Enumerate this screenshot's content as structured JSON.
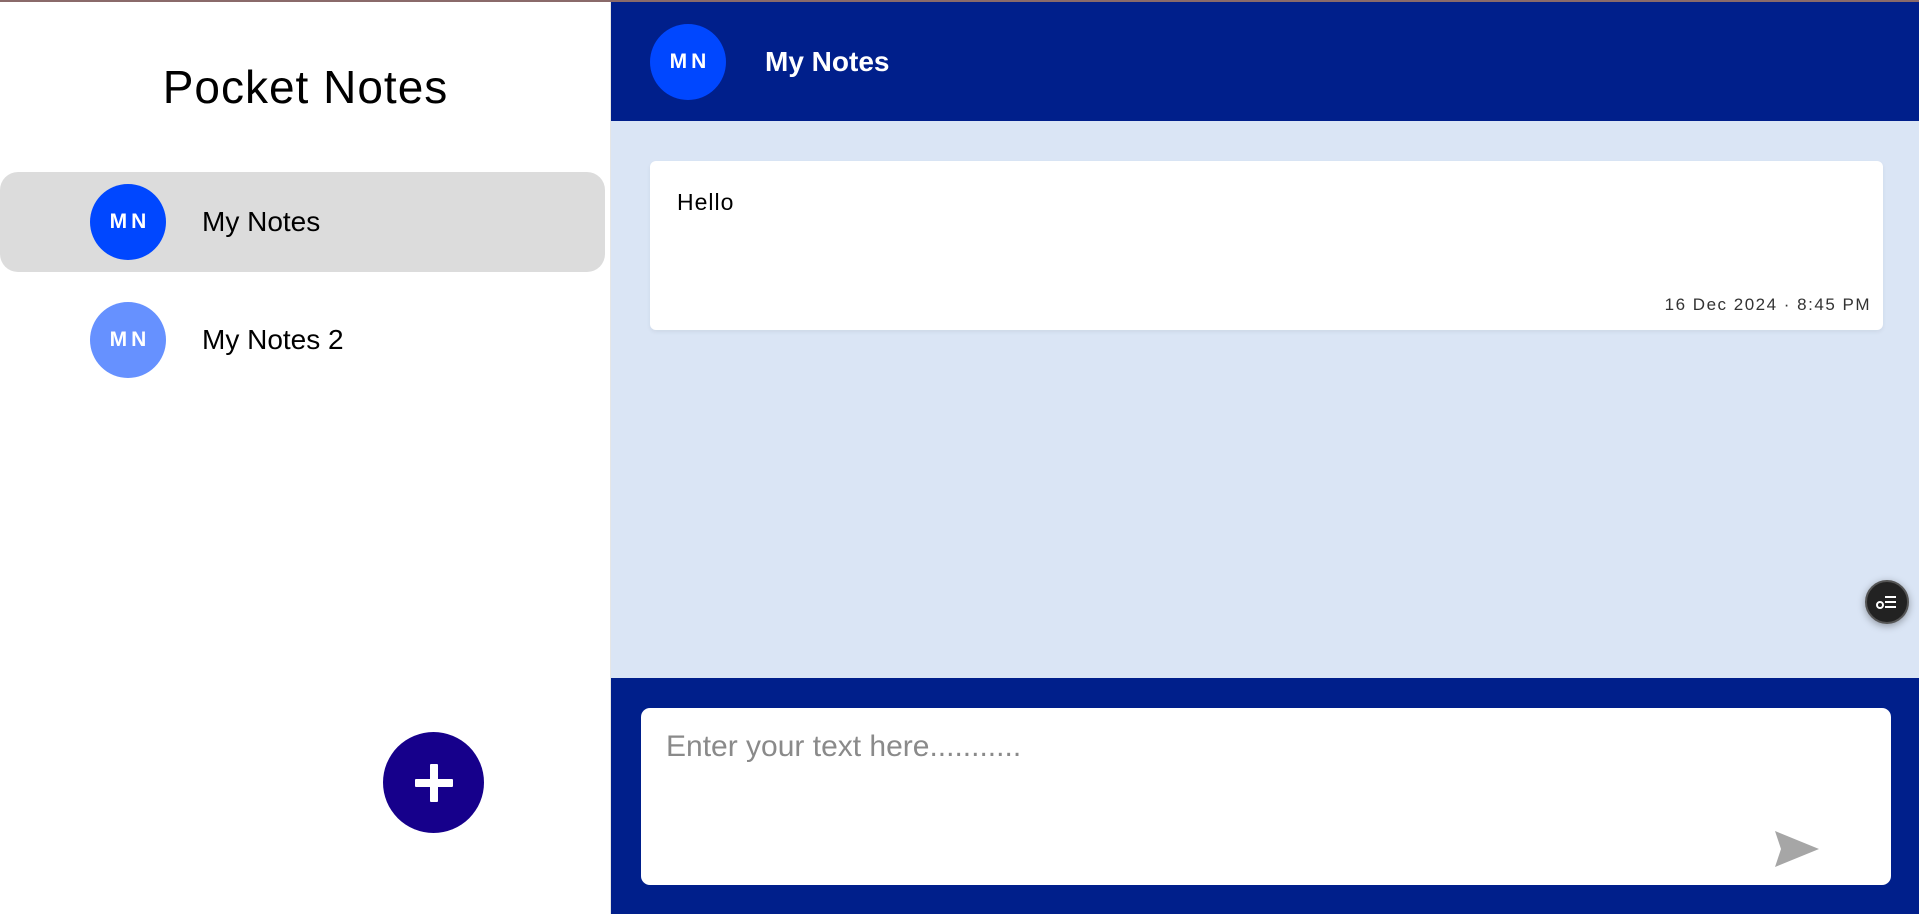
{
  "app": {
    "title": "Pocket Notes"
  },
  "sidebar": {
    "groups": [
      {
        "initials": "MN",
        "name": "My Notes",
        "color": "#0047ff",
        "selected": true
      },
      {
        "initials": "MN",
        "name": "My Notes 2",
        "color": "#6691ff",
        "selected": false
      }
    ],
    "add_button_icon": "plus-icon",
    "add_button_color": "#16008b"
  },
  "header": {
    "initials": "MN",
    "title": "My Notes",
    "avatar_color": "#0047ff",
    "background": "#001f8b"
  },
  "notes": [
    {
      "text": "Hello",
      "meta": "16 Dec 2024 · 8:45 PM"
    }
  ],
  "floating": {
    "icon": "settings-list-icon"
  },
  "composer": {
    "placeholder": "Enter your text here...........",
    "value": "",
    "send_icon": "send-arrow-icon"
  },
  "colors": {
    "main_background": "#dae5f5",
    "selected_item": "#dcdcdc"
  }
}
